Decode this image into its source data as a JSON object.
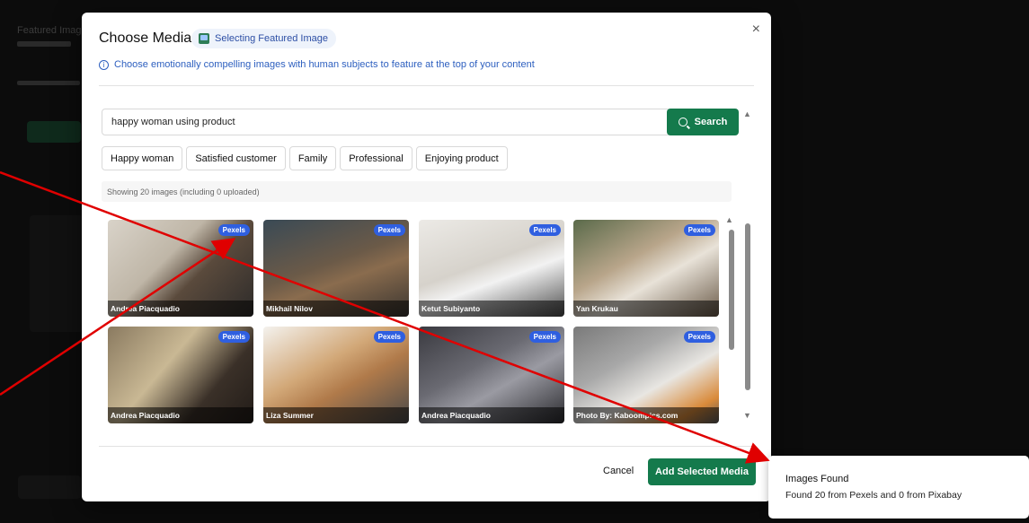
{
  "background": {
    "labels": [
      "Featured Image"
    ]
  },
  "modal": {
    "title": "Choose Media",
    "pill_label": "Selecting Featured Image",
    "hint": "Choose emotionally compelling images with human subjects to feature at the top of your content",
    "close_symbol": "×"
  },
  "search": {
    "value": "happy woman using product",
    "button_label": "Search"
  },
  "chips": [
    "Happy woman",
    "Satisfied customer",
    "Family",
    "Professional",
    "Enjoying product"
  ],
  "status": "Showing 20 images (including 0 uploaded)",
  "images": [
    {
      "source": "Pexels",
      "credit": "Andrea Piacquadio"
    },
    {
      "source": "Pexels",
      "credit": "Mikhail Nilov"
    },
    {
      "source": "Pexels",
      "credit": "Ketut Subiyanto"
    },
    {
      "source": "Pexels",
      "credit": "Yan Krukau"
    },
    {
      "source": "Pexels",
      "credit": "Andrea Piacquadio"
    },
    {
      "source": "Pexels",
      "credit": "Liza Summer"
    },
    {
      "source": "Pexels",
      "credit": "Andrea Piacquadio"
    },
    {
      "source": "Pexels",
      "credit": "Photo By: Kaboompics.com"
    }
  ],
  "footer": {
    "cancel_label": "Cancel",
    "add_label": "Add Selected Media"
  },
  "toast": {
    "title": "Images Found",
    "body": "Found 20 from Pexels and 0 from Pixabay"
  },
  "colors": {
    "accent_green": "#147a4c",
    "badge_blue": "#2f5fe0",
    "annotation_red": "#e00000"
  }
}
